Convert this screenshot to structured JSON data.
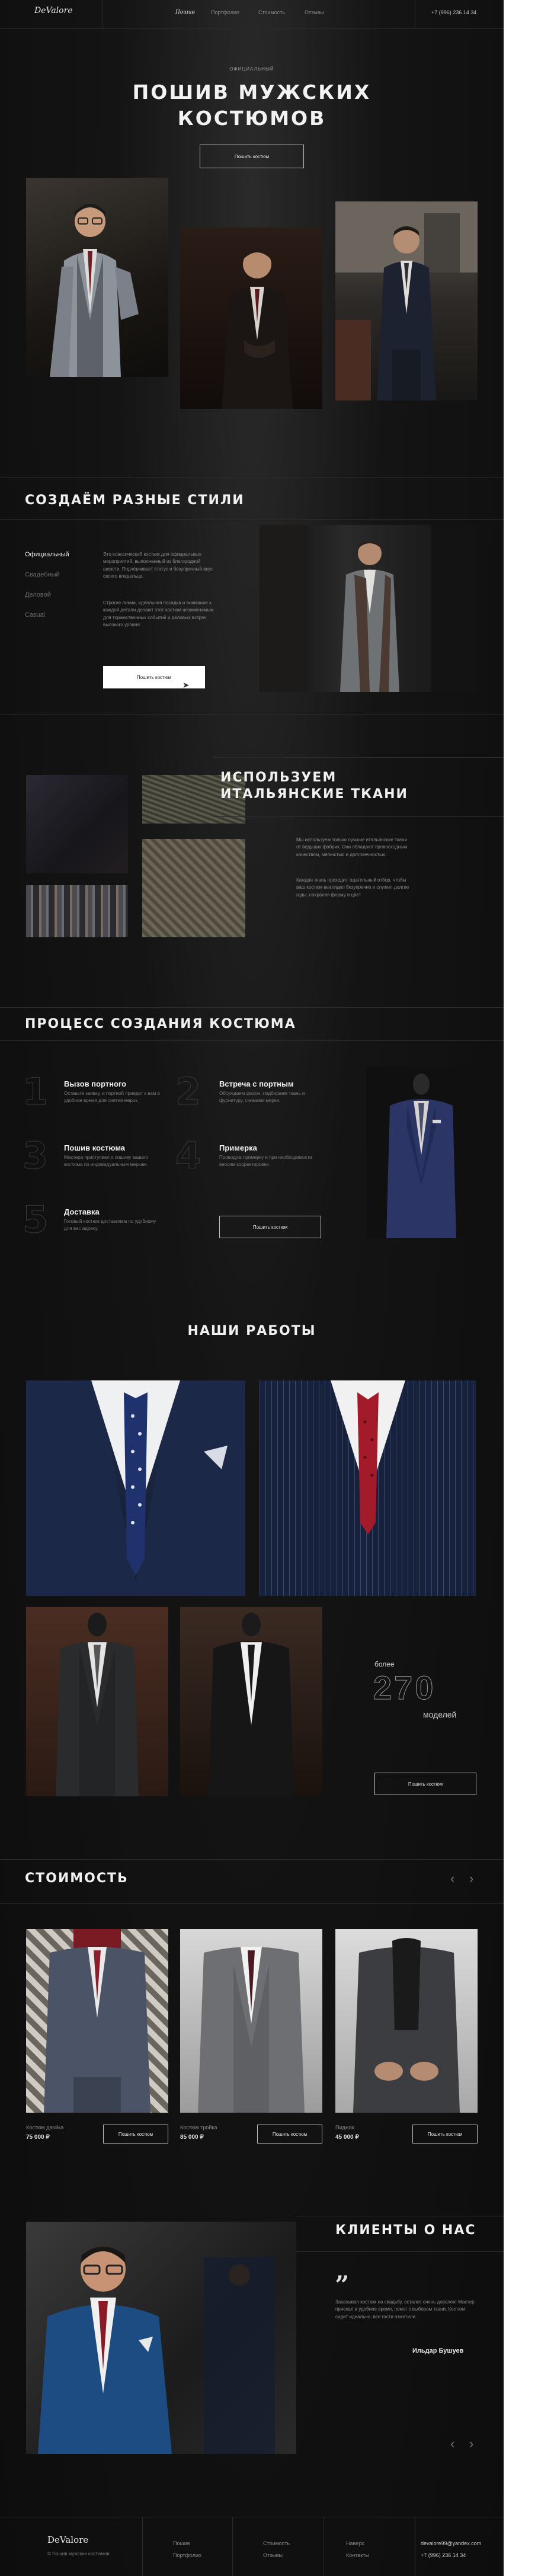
{
  "header": {
    "logo": "DeValore",
    "nav": [
      "Пошив",
      "Портфолио",
      "Стоимость",
      "Отзывы"
    ],
    "phone": "+7 (996) 236 14 34"
  },
  "hero": {
    "eyebrow": "ОФИЦИАЛЬНЫЙ",
    "title_line1": "ПОШИВ МУЖСКИХ",
    "title_line2": "КОСТЮМОВ",
    "cta": "Пошить костюм"
  },
  "styles": {
    "title": "СОЗДАЁМ РАЗНЫЕ СТИЛИ",
    "tabs": [
      "Официальный",
      "Свадебный",
      "Деловой",
      "Casual"
    ],
    "paragraph1": "Это классический костюм для официальных мероприятий, выполненный из благородной шерсти. Подчёркивает статус и безупречный вкус своего владельца.",
    "paragraph2": "Строгие линии, идеальная посадка и внимание к каждой детали делают этот костюм незаменимым для торжественных событий и деловых встреч высокого уровня.",
    "cta": "Пошить костюм"
  },
  "fabrics": {
    "title_line1": "ИСПОЛЬЗУЕМ",
    "title_line2": "ИТАЛЬЯНСКИЕ ТКАНИ",
    "paragraph1": "Мы используем только лучшие итальянские ткани от ведущих фабрик. Они обладают превосходным качеством, мягкостью и долговечностью.",
    "paragraph2": "Каждая ткань проходит тщательный отбор, чтобы ваш костюм выглядел безупречно и служил долгие годы, сохраняя форму и цвет."
  },
  "process": {
    "title": "ПРОЦЕСС СОЗДАНИЯ КОСТЮМА",
    "steps": [
      {
        "num": "1",
        "title": "Вызов портного",
        "desc": "Оставьте заявку, и портной приедет к вам в удобное время для снятия мерок."
      },
      {
        "num": "2",
        "title": "Встреча с портным",
        "desc": "Обсуждаем фасон, подбираем ткань и фурнитуру, снимаем мерки."
      },
      {
        "num": "3",
        "title": "Пошив костюма",
        "desc": "Мастера приступают к пошиву вашего костюма по индивидуальным меркам."
      },
      {
        "num": "4",
        "title": "Примерка",
        "desc": "Проводим примерку и при необходимости вносим корректировки."
      },
      {
        "num": "5",
        "title": "Доставка",
        "desc": "Готовый костюм доставляем по удобному для вас адресу."
      }
    ],
    "cta": "Пошить костюм"
  },
  "works": {
    "title": "НАШИ РАБОТЫ",
    "count_prefix": "более",
    "count": "270",
    "count_suffix": "моделей",
    "cta": "Пошить костюм"
  },
  "pricing": {
    "title": "СТОИМОСТЬ",
    "items": [
      {
        "name": "Костюм двойка",
        "price": "75 000 ₽",
        "cta": "Пошить костюм"
      },
      {
        "name": "Костюм тройка",
        "price": "85 000 ₽",
        "cta": "Пошить костюм"
      },
      {
        "name": "Пиджак",
        "price": "45 000 ₽",
        "cta": "Пошить костюм"
      }
    ],
    "prev": "‹",
    "next": "›"
  },
  "reviews": {
    "title": "КЛИЕНТЫ О НАС",
    "quote_mark": "„",
    "text": "Заказывал костюм на свадьбу, остался очень доволен! Мастер приехал в удобное время, помог с выбором ткани. Костюм сидит идеально, все гости отметили.",
    "author": "Ильдар Бушуев",
    "prev": "‹",
    "next": "›"
  },
  "footer": {
    "logo": "DeValore",
    "tagline": "© Пошив мужских костюмов",
    "links": [
      "Пошив",
      "Портфолио",
      "Стоимость",
      "Отзывы",
      "Наверх",
      "Контакты"
    ],
    "email": "devalore99@yandex.com",
    "phone": "+7 (996) 236 14 34"
  }
}
